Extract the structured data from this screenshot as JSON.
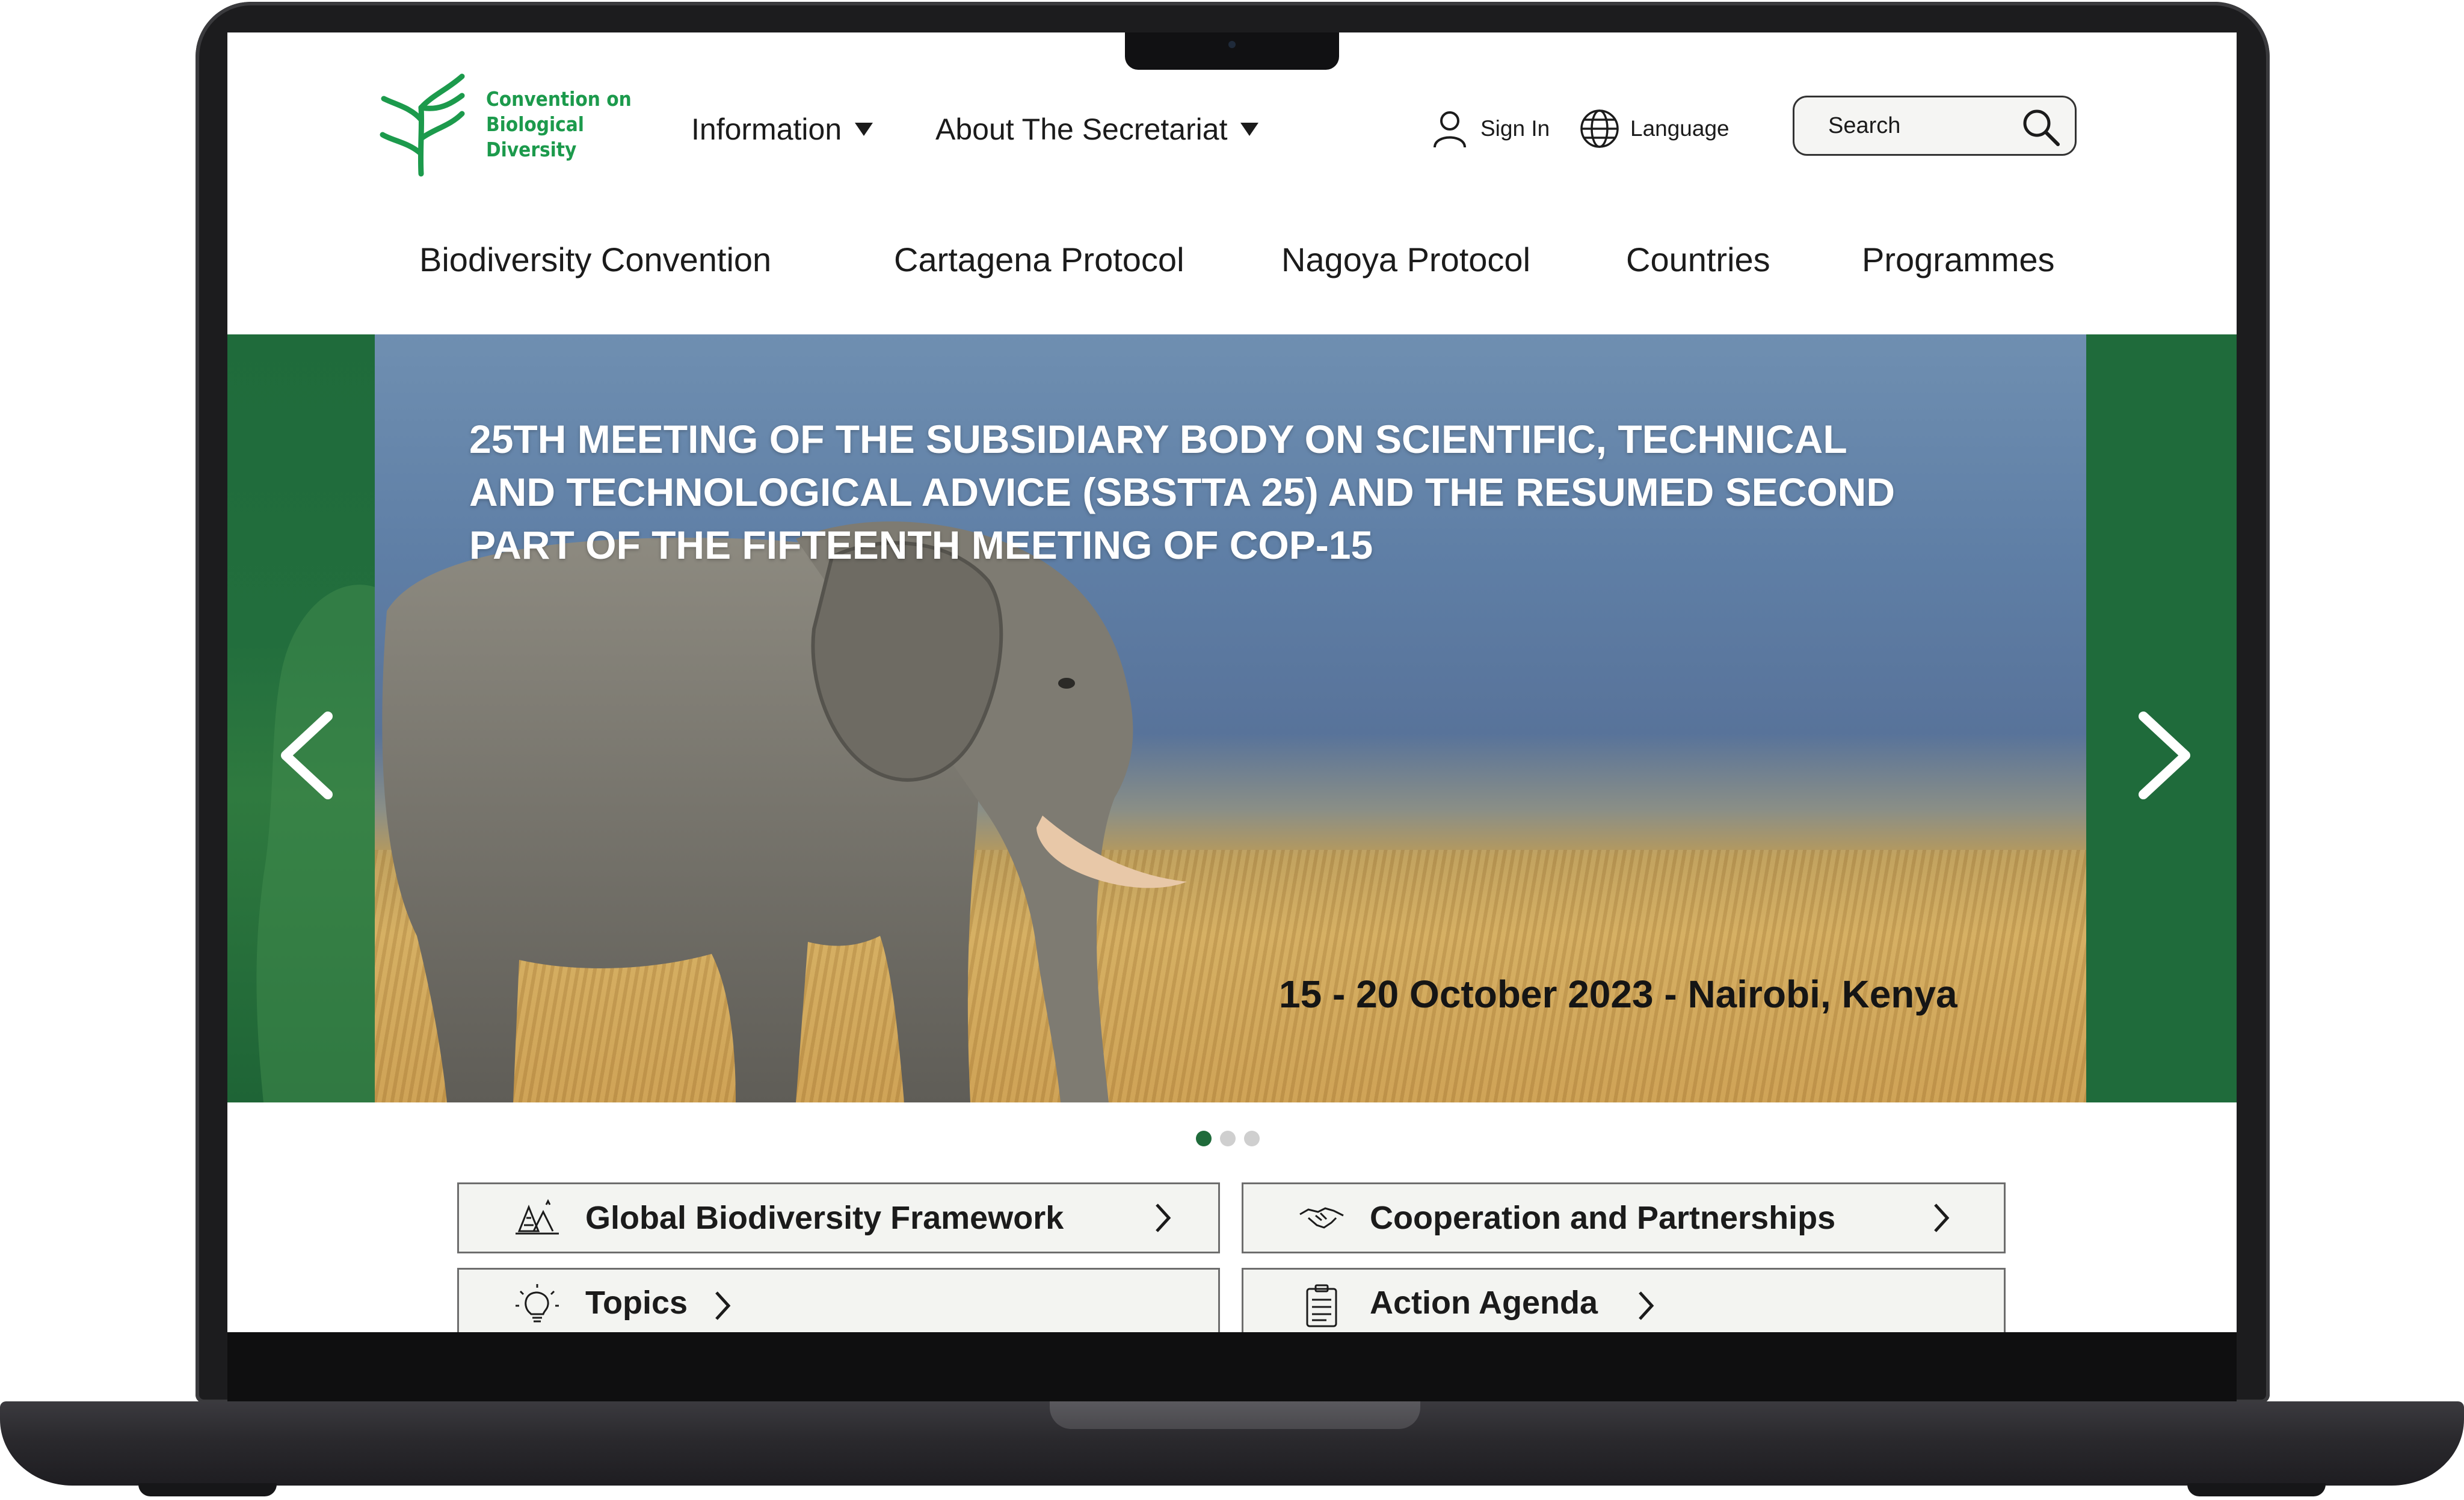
{
  "logo": {
    "line1": "Convention on",
    "line2": "Biological Diversity"
  },
  "topnav": [
    {
      "label": "Information"
    },
    {
      "label": "About The Secretariat"
    }
  ],
  "utility": {
    "sign_in": "Sign In",
    "language": "Language"
  },
  "search": {
    "placeholder": "Search"
  },
  "mainnav": [
    "Biodiversity Convention",
    "Cartagena Protocol",
    "Nagoya Protocol",
    "Countries",
    "Programmes"
  ],
  "hero": {
    "title_lines": [
      "25TH MEETING OF THE SUBSIDIARY BODY ON SCIENTIFIC, TECHNICAL",
      "AND TECHNOLOGICAL ADVICE (SBSTTA 25) AND THE RESUMED SECOND",
      "PART OF THE FIFTEENTH MEETING OF COP-15"
    ],
    "date": "15 - 20 October 2023 - Nairobi, Kenya",
    "slide_count": 3,
    "active_slide": 1
  },
  "cards": [
    {
      "label": "Global Biodiversity Framework",
      "icon": "forest-icon"
    },
    {
      "label": "Cooperation and Partnerships",
      "icon": "handshake-icon"
    },
    {
      "label": "Topics",
      "icon": "lightbulb-icon"
    },
    {
      "label": "Action Agenda",
      "icon": "clipboard-icon"
    }
  ],
  "colors": {
    "brand_green": "#1c9a4c",
    "hero_panel": "#1f6b3b",
    "card_bg": "#f3f4f1"
  }
}
